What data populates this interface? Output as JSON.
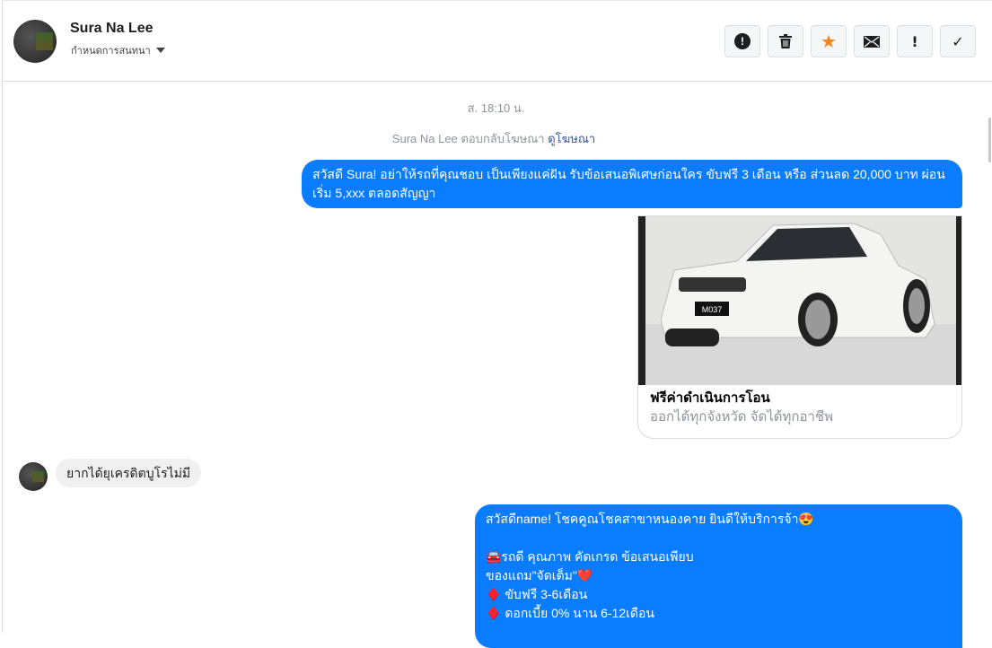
{
  "header": {
    "name": "Sura Na Lee",
    "subtitle": "กำหนดการสนทนา",
    "tools": [
      {
        "icon": "spam-icon",
        "glyph": "!"
      },
      {
        "icon": "trash-icon",
        "glyph": "🗑"
      },
      {
        "icon": "star-icon",
        "glyph": "★"
      },
      {
        "icon": "envelope-icon",
        "glyph": "✉"
      },
      {
        "icon": "important-icon",
        "glyph": "!"
      },
      {
        "icon": "check-icon",
        "glyph": "✓"
      }
    ]
  },
  "thread": {
    "timestamp": "ส. 18:10 น.",
    "reply_note": "Sura Na Lee ตอบกลับโฆษณา",
    "reply_link": "ดูโฆษณา",
    "msg1": "สวัสดี Sura! อย่าให้รถที่คุณชอบ เป็นเพียงแค่ฝัน รับข้อเสนอพิเศษก่อนใคร ขับฟรี 3 เดือน หรือ ส่วนลด 20,000 บาท ผ่อนเริ่ม 5,xxx ตลอดสัญญา",
    "card": {
      "plate": "M037",
      "title": "ฟรีค่าดำเนินการโอน",
      "subtitle": "ออกได้ทุกจังหวัด จัดได้ทุกอาชีพ"
    },
    "incoming": "ยากได้ยุเครดิตบูโรไม่มี",
    "msg2": "สวัสดีname! โชคคูณโชคสาขาหนองคาย ยินดีให้บริการจ้า😍\n\n🚘รถดี คุณภาพ คัดเกรด ข้อเสนอเพียบ\nของแถม\"จัดเต็ม\"❤️\n♦️ ขับฟรี 3-6เดือน\n♦️ ดอกเบี้ย 0% นาน 6-12เดือน"
  },
  "colors": {
    "accent": "#0a7cff",
    "star": "#f5831f"
  }
}
